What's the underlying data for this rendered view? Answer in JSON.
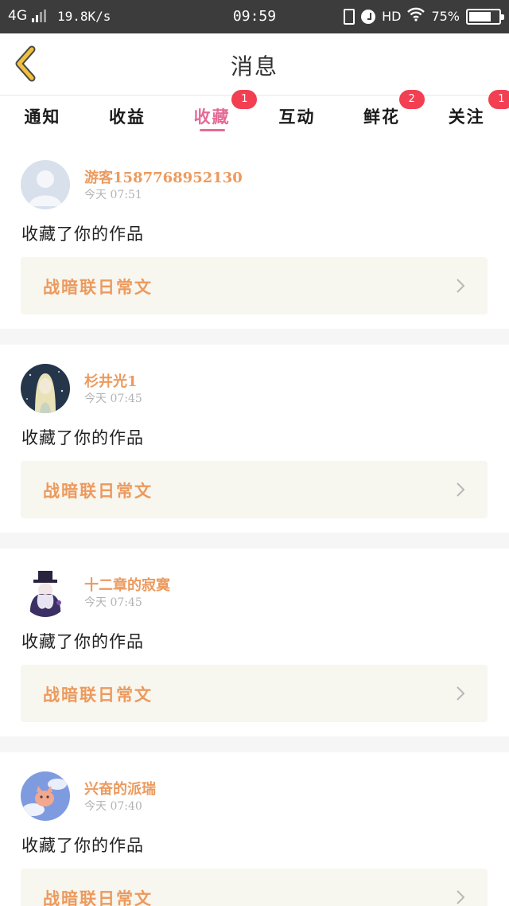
{
  "status_bar": {
    "network": "4G",
    "speed": "19.8K/s",
    "time": "09:59",
    "hd": "HD",
    "battery": "75%",
    "battery_level": 0.75
  },
  "header": {
    "title": "消息"
  },
  "tabs": [
    {
      "label": "通知",
      "badge": ""
    },
    {
      "label": "收益",
      "badge": ""
    },
    {
      "label": "收藏",
      "badge": "1",
      "active": true
    },
    {
      "label": "互动",
      "badge": ""
    },
    {
      "label": "鲜花",
      "badge": "2"
    },
    {
      "label": "关注",
      "badge": "1"
    }
  ],
  "messages": [
    {
      "user": "游客1587768952130",
      "time": "今天 07:51",
      "action": "收藏了你的作品",
      "work": "战暗联日常文",
      "avatar": "default-avatar-icon"
    },
    {
      "user": "杉井光1",
      "time": "今天 07:45",
      "action": "收藏了你的作品",
      "work": "战暗联日常文",
      "avatar": "anime-girl-avatar"
    },
    {
      "user": "十二章的寂寞",
      "time": "今天 07:45",
      "action": "收藏了你的作品",
      "work": "战暗联日常文",
      "avatar": "top-hat-character-avatar"
    },
    {
      "user": "兴奋的派瑞",
      "time": "今天 07:40",
      "action": "收藏了你的作品",
      "work": "战暗联日常文",
      "avatar": "sky-cat-avatar"
    }
  ],
  "colors": {
    "accent": "#e66a97",
    "name": "#ec9a5e",
    "badge": "#f23f52",
    "back_arrow": "#f0c23c"
  }
}
